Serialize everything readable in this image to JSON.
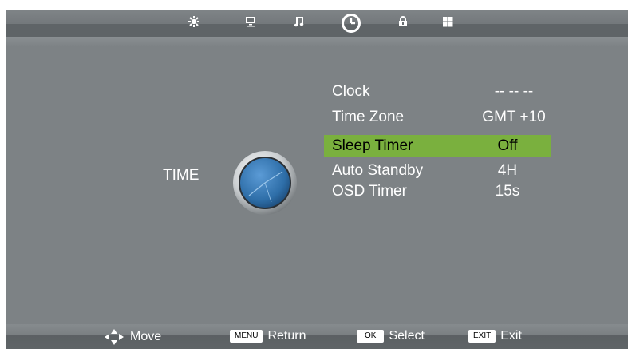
{
  "tabs": [
    {
      "icon": "picture-icon",
      "selected": false
    },
    {
      "icon": "monitor-icon",
      "selected": false
    },
    {
      "icon": "music-note-icon",
      "selected": false
    },
    {
      "icon": "clock-icon",
      "selected": true
    },
    {
      "icon": "lock-icon",
      "selected": false
    },
    {
      "icon": "grid-icon",
      "selected": false
    }
  ],
  "section": {
    "title": "TIME",
    "icon": "clock-icon"
  },
  "menu": [
    {
      "label": "Clock",
      "value": "-- -- --"
    },
    {
      "label": "Time Zone",
      "value": "GMT +10"
    },
    {
      "label": "Sleep Timer",
      "value": "Off",
      "selected": true
    },
    {
      "label": "Auto Standby",
      "value": "4H"
    },
    {
      "label": "OSD Timer",
      "value": "15s"
    }
  ],
  "footer": {
    "move": {
      "label": "Move",
      "icon": "arrows-icon"
    },
    "return": {
      "key": "MENU",
      "label": "Return"
    },
    "select": {
      "key": "OK",
      "label": "Select"
    },
    "exit": {
      "key": "EXIT",
      "label": "Exit"
    }
  },
  "colors": {
    "background": "#7d8285",
    "highlight": "#7ab03e",
    "clock_face": "#2e6ea8"
  }
}
